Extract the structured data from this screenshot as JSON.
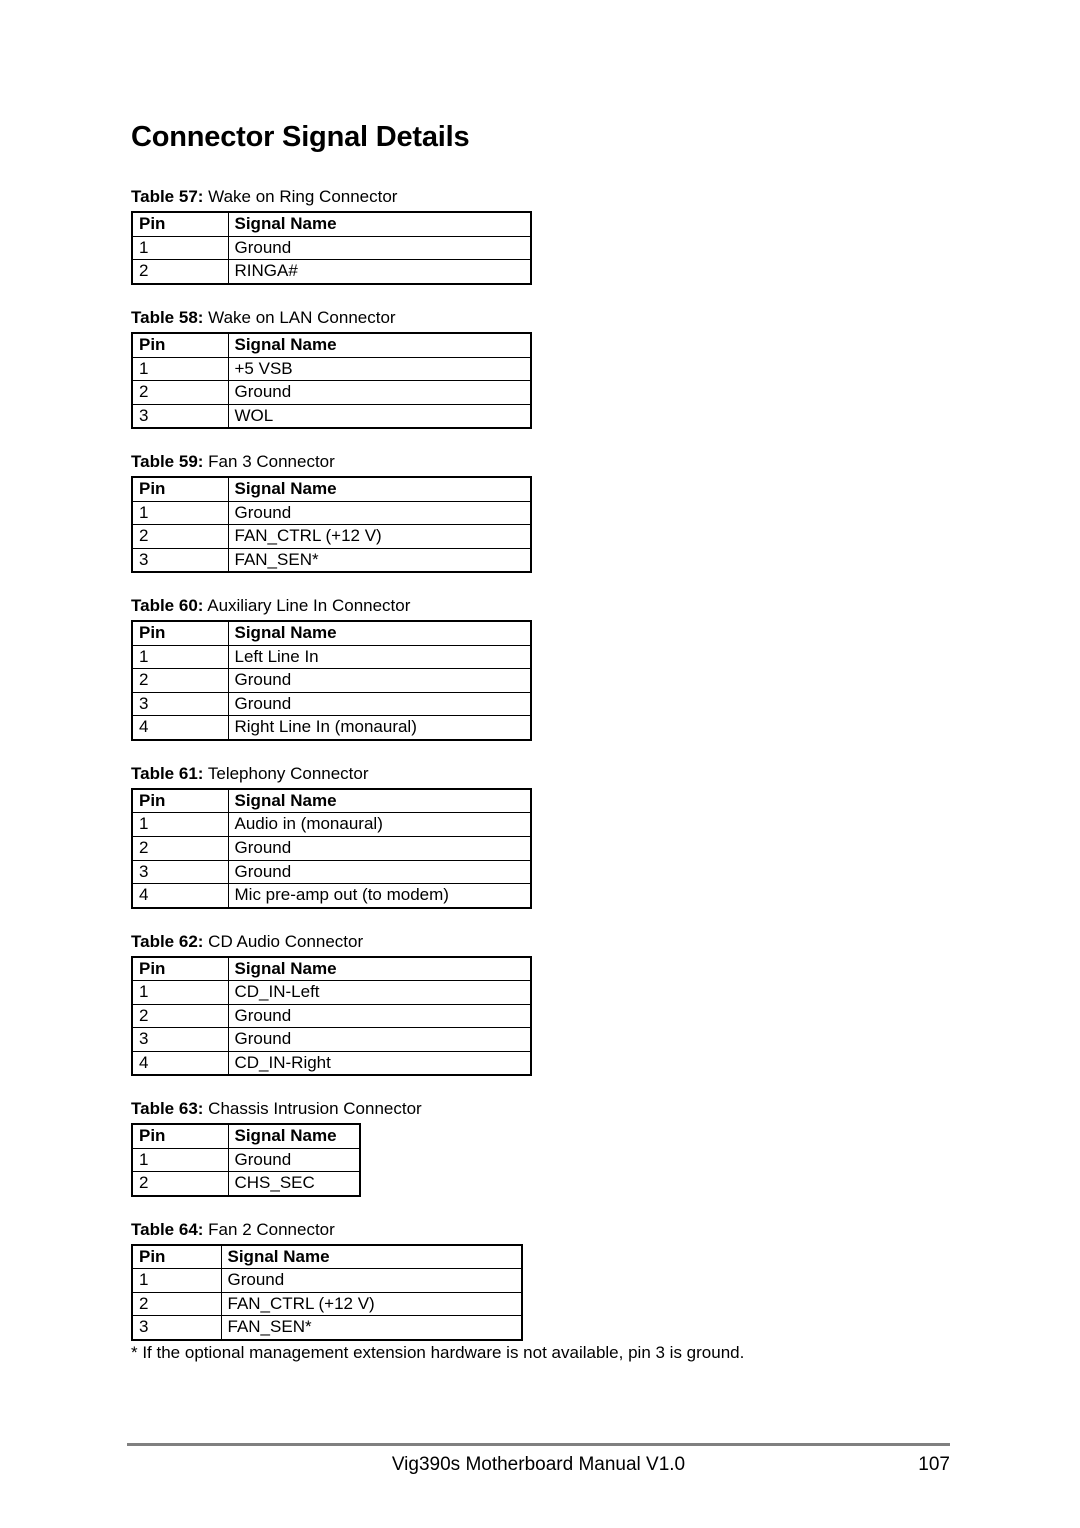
{
  "heading": "Connector Signal Details",
  "columns": [
    "Pin",
    "Signal Name"
  ],
  "tables": [
    {
      "number": "Table 57:",
      "title": "Wake on Ring Connector",
      "width": "standard",
      "rows": [
        {
          "pin": "1",
          "signal": "Ground"
        },
        {
          "pin": "2",
          "signal": "RINGA#"
        }
      ]
    },
    {
      "number": "Table 58:",
      "title": "Wake on LAN Connector",
      "width": "standard",
      "rows": [
        {
          "pin": "1",
          "signal": "+5 VSB"
        },
        {
          "pin": "2",
          "signal": "Ground"
        },
        {
          "pin": "3",
          "signal": "WOL"
        }
      ]
    },
    {
      "number": "Table 59:",
      "title": "Fan 3 Connector",
      "width": "standard",
      "rows": [
        {
          "pin": "1",
          "signal": "Ground"
        },
        {
          "pin": "2",
          "signal": "FAN_CTRL (+12 V)"
        },
        {
          "pin": "3",
          "signal": "FAN_SEN*"
        }
      ]
    },
    {
      "number": "Table 60:",
      "title": "Auxiliary Line In Connector",
      "width": "standard",
      "rows": [
        {
          "pin": "1",
          "signal": "Left Line In"
        },
        {
          "pin": "2",
          "signal": "Ground"
        },
        {
          "pin": "3",
          "signal": "Ground"
        },
        {
          "pin": "4",
          "signal": "Right Line In (monaural)"
        }
      ]
    },
    {
      "number": "Table 61:",
      "title": "Telephony Connector",
      "width": "standard",
      "rows": [
        {
          "pin": "1",
          "signal": "Audio in (monaural)"
        },
        {
          "pin": "2",
          "signal": "Ground"
        },
        {
          "pin": "3",
          "signal": "Ground"
        },
        {
          "pin": "4",
          "signal": "Mic pre-amp out (to modem)"
        }
      ]
    },
    {
      "number": "Table 62:",
      "title": "CD Audio Connector",
      "width": "standard",
      "rows": [
        {
          "pin": "1",
          "signal": "CD_IN-Left"
        },
        {
          "pin": "2",
          "signal": "Ground"
        },
        {
          "pin": "3",
          "signal": "Ground"
        },
        {
          "pin": "4",
          "signal": "CD_IN-Right"
        }
      ]
    },
    {
      "number": "Table 63:",
      "title": "Chassis Intrusion Connector",
      "width": "narrow",
      "rows": [
        {
          "pin": "1",
          "signal": "Ground"
        },
        {
          "pin": "2",
          "signal": "CHS_SEC"
        }
      ]
    },
    {
      "number": "Table 64:",
      "title": "Fan 2 Connector",
      "width": "fan2",
      "rows": [
        {
          "pin": "1",
          "signal": "Ground"
        },
        {
          "pin": "2",
          "signal": "FAN_CTRL (+12 V)"
        },
        {
          "pin": "3",
          "signal": "FAN_SEN*"
        }
      ]
    }
  ],
  "footnote": "* If the optional management extension hardware is not available, pin 3 is ground.",
  "footer": {
    "manual_title": "Vig390s Motherboard Manual V1.0",
    "page_number": "107"
  }
}
